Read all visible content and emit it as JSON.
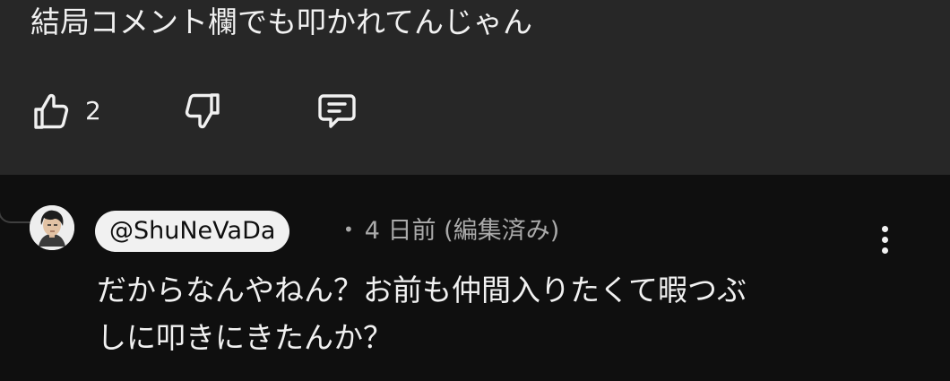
{
  "parent_comment": {
    "text": "結局コメント欄でも叩かれてんじゃん",
    "like_count": "2",
    "icons": {
      "like": "thumbs-up-icon",
      "dislike": "thumbs-down-icon",
      "reply": "comment-icon"
    }
  },
  "reply": {
    "handle": "@ShuNeVaDa",
    "separator": "•",
    "time": "4 日前",
    "edited": "(編集済み)",
    "text": "だからなんやねん？お前も仲間入りたくて暇つぶ\nしに叩きにきたんか？",
    "menu_icon": "more-vertical-icon"
  },
  "colors": {
    "top_background": "#272727",
    "bottom_background": "#0f0f0f",
    "text_primary": "#f1f1f1",
    "text_secondary": "#aaaaaa",
    "chip_background": "#f1f1f1"
  }
}
